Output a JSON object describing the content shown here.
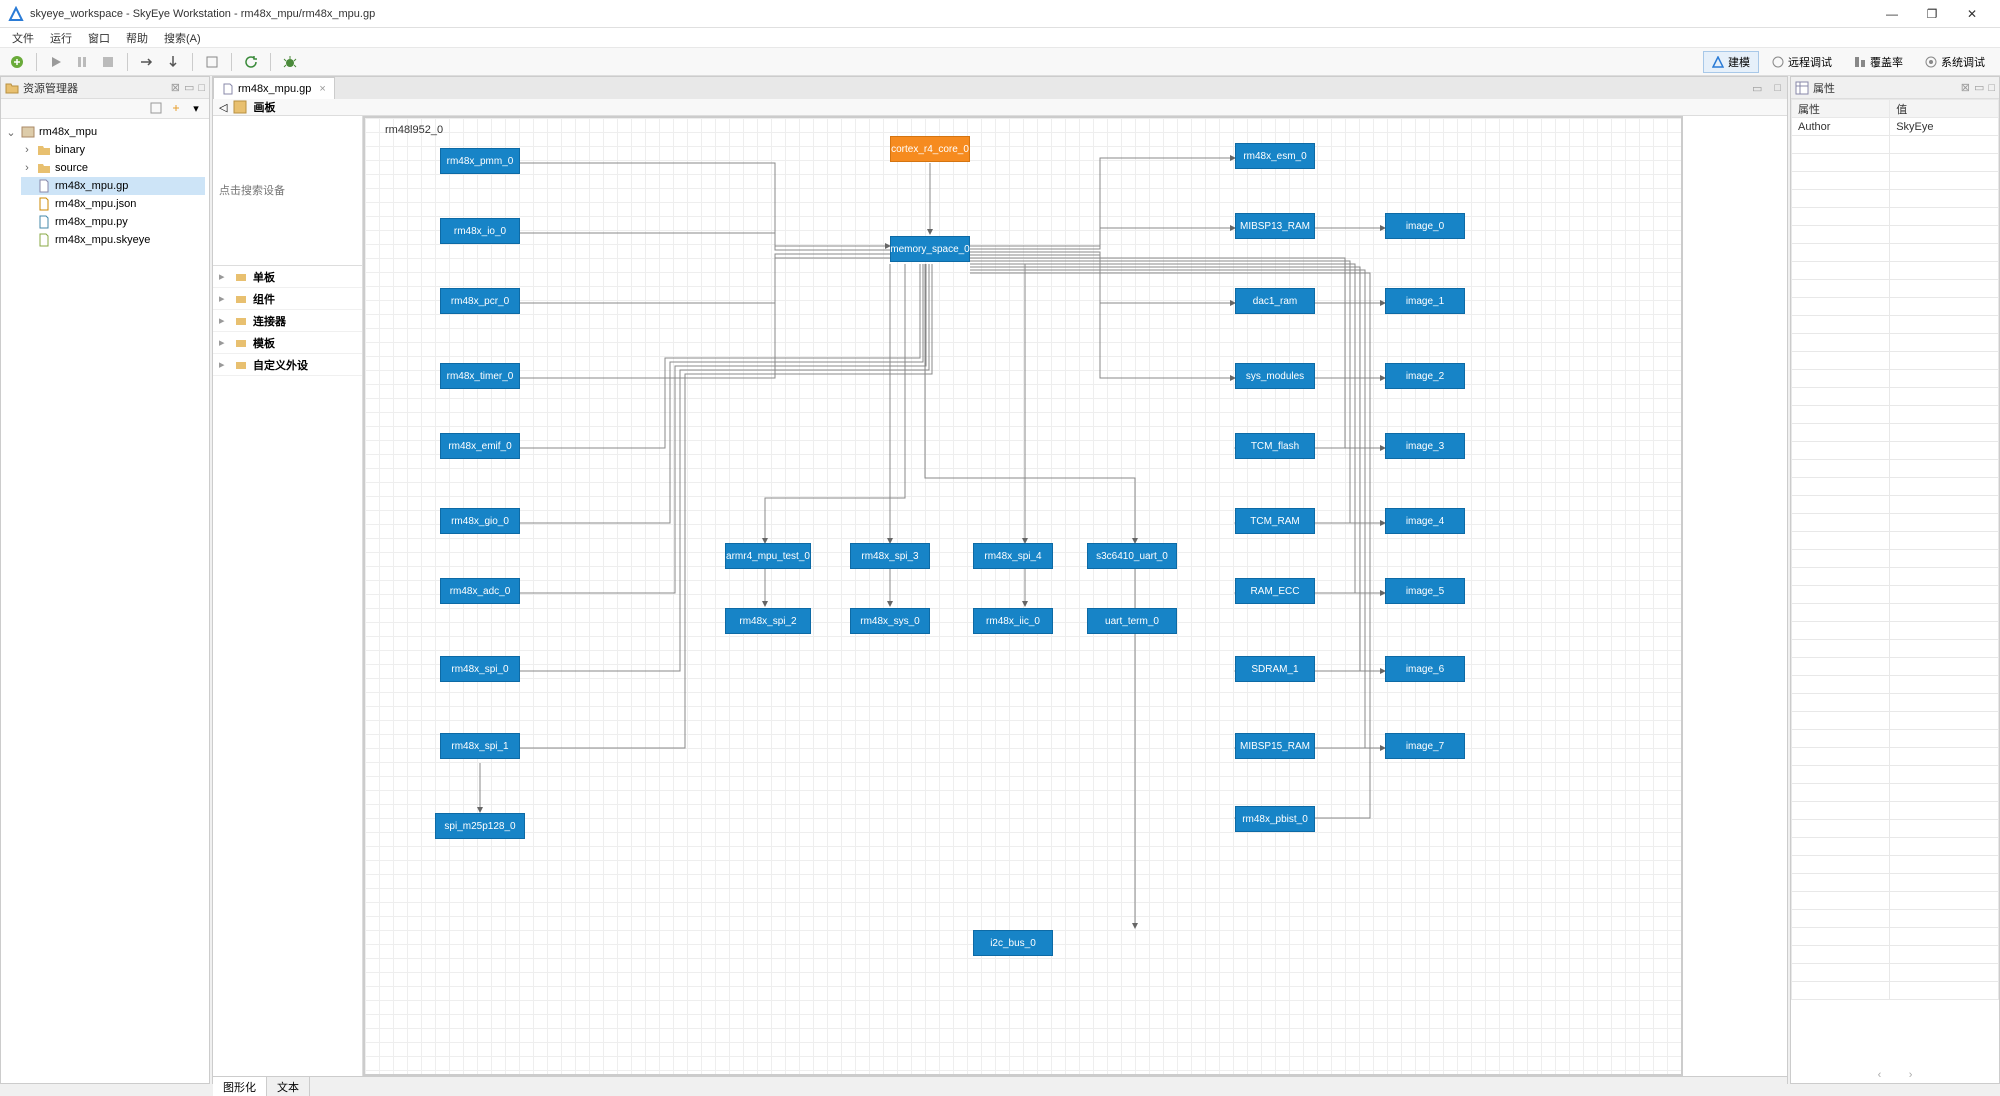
{
  "window": {
    "title": "skyeye_workspace - SkyEye Workstation - rm48x_mpu/rm48x_mpu.gp"
  },
  "menu": {
    "file": "文件",
    "run": "运行",
    "window": "窗口",
    "help": "帮助",
    "search": "搜索(A)"
  },
  "toolbar_right": {
    "model": "建模",
    "remote_debug": "远程调试",
    "coverage": "覆盖率",
    "sys_debug": "系统调试"
  },
  "explorer": {
    "title": "资源管理器",
    "root": "rm48x_mpu",
    "folders": {
      "binary": "binary",
      "source": "source"
    },
    "files": {
      "gp": "rm48x_mpu.gp",
      "json": "rm48x_mpu.json",
      "py": "rm48x_mpu.py",
      "skyeye": "rm48x_mpu.skyeye"
    }
  },
  "editor": {
    "tab": "rm48x_mpu.gp",
    "canvas_label": "画板",
    "search_placeholder": "点击搜索设备",
    "palette": {
      "board": "单板",
      "component": "组件",
      "connector": "连接器",
      "template": "模板",
      "custom": "自定义外设"
    },
    "canvas_title": "rm48l952_0",
    "nodes": {
      "cortex": "cortex_r4_core_0",
      "memory": "memory_space_0",
      "pmm": "rm48x_pmm_0",
      "io": "rm48x_io_0",
      "pcr": "rm48x_pcr_0",
      "timer": "rm48x_timer_0",
      "emif": "rm48x_emif_0",
      "gio": "rm48x_gio_0",
      "adc": "rm48x_adc_0",
      "spi0": "rm48x_spi_0",
      "spi1": "rm48x_spi_1",
      "m25": "spi_m25p128_0",
      "mpu_test": "armr4_mpu_test_0",
      "spi2": "rm48x_spi_2",
      "spi3": "rm48x_spi_3",
      "sys": "rm48x_sys_0",
      "spi4": "rm48x_spi_4",
      "iic": "rm48x_iic_0",
      "uart": "s3c6410_uart_0",
      "uart_term": "uart_term_0",
      "i2c_bus": "i2c_bus_0",
      "esm": "rm48x_esm_0",
      "mibsp13": "MIBSP13_RAM",
      "dac1": "dac1_ram",
      "sysmod": "sys_modules",
      "tcmflash": "TCM_flash",
      "tcmram": "TCM_RAM",
      "ramecc": "RAM_ECC",
      "sdram": "SDRAM_1",
      "mibsp15": "MIBSP15_RAM",
      "pbist": "rm48x_pbist_0",
      "img0": "image_0",
      "img1": "image_1",
      "img2": "image_2",
      "img3": "image_3",
      "img4": "image_4",
      "img5": "image_5",
      "img6": "image_6",
      "img7": "image_7"
    },
    "bottom_tabs": {
      "graph": "图形化",
      "text": "文本"
    }
  },
  "properties": {
    "title": "属性",
    "col_attr": "属性",
    "col_val": "值",
    "rows": [
      {
        "k": "Author",
        "v": "SkyEye"
      }
    ]
  }
}
